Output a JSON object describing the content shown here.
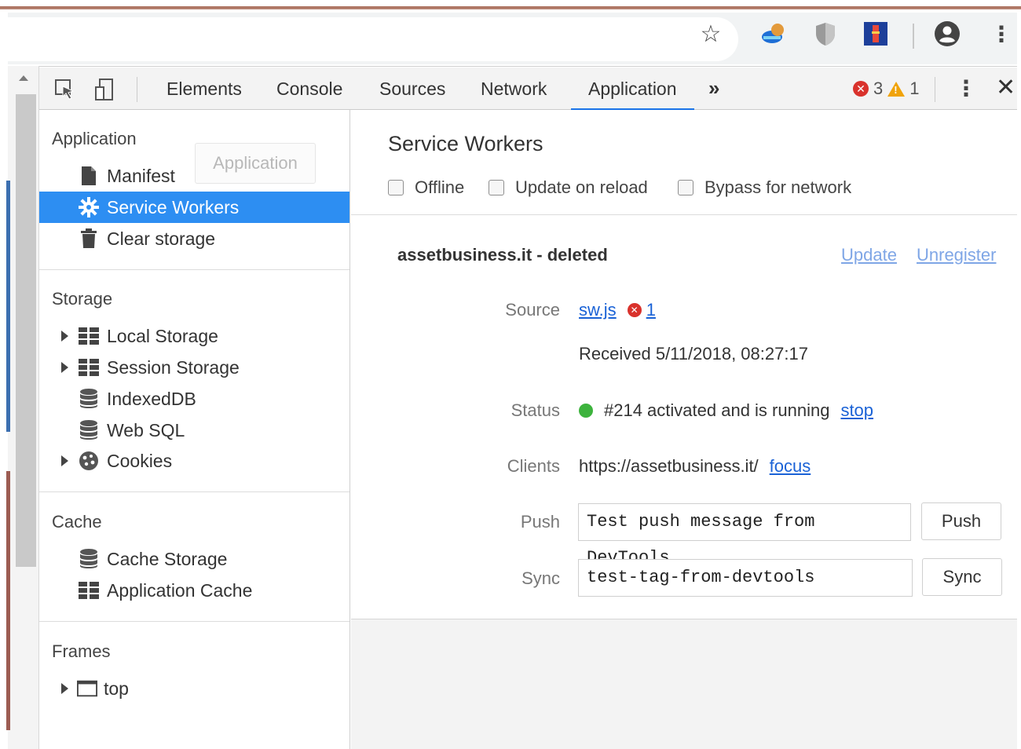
{
  "browser": {
    "star_icon": "star-icon",
    "extensions": [
      "cloud-ext-icon",
      "shield-ext-icon",
      "tower-ext-icon"
    ],
    "avatar_icon": "account-icon",
    "menu_icon": "kebab-icon"
  },
  "devtools": {
    "tabs": [
      {
        "label": "Elements",
        "active": false
      },
      {
        "label": "Console",
        "active": false
      },
      {
        "label": "Sources",
        "active": false
      },
      {
        "label": "Network",
        "active": false
      },
      {
        "label": "Application",
        "active": true
      }
    ],
    "more_tabs": "»",
    "error_count": "3",
    "warning_count": "1",
    "colors": {
      "accent": "#1a73e8",
      "selected": "#2d8ef2",
      "error": "#d9322c",
      "warning": "#f0a30a",
      "running": "#3db33d"
    }
  },
  "sidebar": {
    "application": {
      "title": "Application",
      "tooltip": "Application",
      "items": [
        {
          "label": "Manifest",
          "icon": "file-icon",
          "selected": false
        },
        {
          "label": "Service Workers",
          "icon": "gear-icon",
          "selected": true
        },
        {
          "label": "Clear storage",
          "icon": "trash-icon",
          "selected": false
        }
      ]
    },
    "storage": {
      "title": "Storage",
      "items": [
        {
          "label": "Local Storage",
          "icon": "grid-icon",
          "expandable": true
        },
        {
          "label": "Session Storage",
          "icon": "grid-icon",
          "expandable": true
        },
        {
          "label": "IndexedDB",
          "icon": "database-icon",
          "expandable": false
        },
        {
          "label": "Web SQL",
          "icon": "database-icon",
          "expandable": false
        },
        {
          "label": "Cookies",
          "icon": "cookie-icon",
          "expandable": true
        }
      ]
    },
    "cache": {
      "title": "Cache",
      "items": [
        {
          "label": "Cache Storage",
          "icon": "database-icon"
        },
        {
          "label": "Application Cache",
          "icon": "grid-icon"
        }
      ]
    },
    "frames": {
      "title": "Frames",
      "items": [
        {
          "label": "top",
          "icon": "frame-icon",
          "expandable": true
        }
      ]
    }
  },
  "main": {
    "title": "Service Workers",
    "options": [
      {
        "label": "Offline",
        "checked": false
      },
      {
        "label": "Update on reload",
        "checked": false
      },
      {
        "label": "Bypass for network",
        "checked": false
      }
    ],
    "worker": {
      "origin": "assetbusiness.it - deleted",
      "update_link": "Update",
      "unregister_link": "Unregister",
      "source_label": "Source",
      "source_file": "sw.js",
      "source_errors": "1",
      "received": "Received 5/11/2018, 08:27:17",
      "status_label": "Status",
      "status_text": "#214 activated and is running",
      "stop_link": "stop",
      "clients_label": "Clients",
      "clients_url": "https://assetbusiness.it/",
      "focus_link": "focus",
      "push_label": "Push",
      "push_value": "Test push message from DevTools",
      "push_button": "Push",
      "sync_label": "Sync",
      "sync_value": "test-tag-from-devtools",
      "sync_button": "Sync"
    }
  }
}
